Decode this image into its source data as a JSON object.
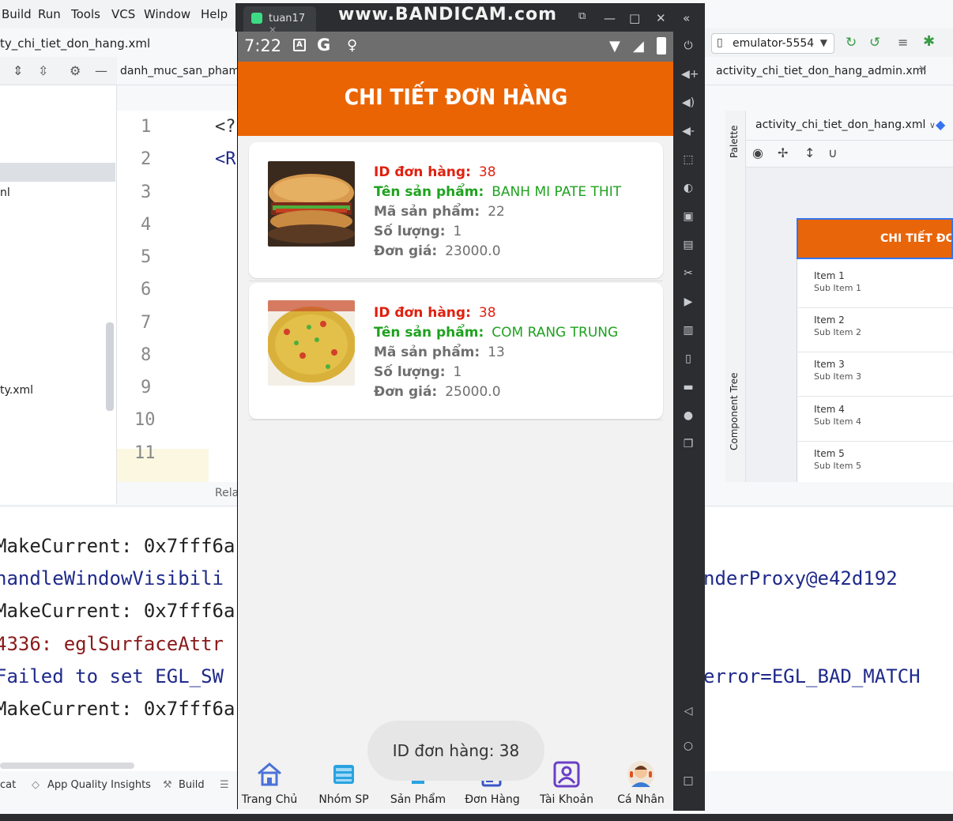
{
  "ide": {
    "menu": [
      "Build",
      "Run",
      "Tools",
      "VCS",
      "Window",
      "Help"
    ],
    "file_path": "ty_chi_tiet_don_hang.xml",
    "editor_tab": "danh_muc_san_pham.x",
    "tree_items": [
      "nl",
      "ty.xml"
    ],
    "line_numbers": [
      "1",
      "2",
      "3",
      "4",
      "5",
      "6",
      "7",
      "8",
      "9",
      "10",
      "11"
    ],
    "code_fragments": [
      "<?",
      "<R"
    ],
    "rela_tab": "Rela",
    "logcat_lines": [
      {
        "text": "MakeCurrent: 0x7fff6a",
        "color": "#1a1a1a"
      },
      {
        "text": " handleWindowVisibili",
        "color": "#1f2a8a"
      },
      {
        "text": "nderProxy@e42d192",
        "color": "#1f2a8a"
      },
      {
        "text": "MakeCurrent: 0x7fff6a",
        "color": "#1a1a1a"
      },
      {
        "text": " 4336: eglSurfaceAttr",
        "color": "#8a1a1a"
      },
      {
        "text": " Failed to set EGL_SW",
        "color": "#1f2a8a"
      },
      {
        "text": "error=EGL_BAD_MATCH",
        "color": "#1f2a8a"
      },
      {
        "text": "MakeCurrent: 0x7fff6a",
        "color": "#1a1a1a"
      }
    ],
    "bottom_tools": [
      "cat",
      "App Quality Insights",
      "Build"
    ],
    "device": "emulator-5554",
    "right_tab": "activity_chi_tiet_don_hang_admin.xml",
    "design_file": "activity_chi_tiet_don_hang.xml",
    "palette_label": "Palette",
    "component_tree_label": "Component Tree",
    "preview_title": "CHI TIẾT ĐƠN",
    "preview_items": [
      {
        "title": "Item 1",
        "sub": "Sub Item 1"
      },
      {
        "title": "Item 2",
        "sub": "Sub Item 2"
      },
      {
        "title": "Item 3",
        "sub": "Sub Item 3"
      },
      {
        "title": "Item 4",
        "sub": "Sub Item 4"
      },
      {
        "title": "Item 5",
        "sub": "Sub Item 5"
      }
    ]
  },
  "emulator": {
    "tab_name": "tuan17",
    "watermark": "www.BANDICAM.com"
  },
  "phone": {
    "time": "7:22",
    "title": "CHI TIẾT ĐƠN HÀNG",
    "orders": [
      {
        "id_label": "ID đơn hàng:",
        "id": "38",
        "name_label": "Tên sản phẩm:",
        "name": "BANH MI PATE THIT",
        "code_label": "Mã sản phẩm:",
        "code": "22",
        "qty_label": "Số lượng:",
        "qty": "1",
        "price_label": "Đơn giá:",
        "price": "23000.0"
      },
      {
        "id_label": "ID đơn hàng:",
        "id": "38",
        "name_label": "Tên sản phẩm:",
        "name": "COM RANG TRUNG",
        "code_label": "Mã sản phẩm:",
        "code": "13",
        "qty_label": "Số lượng:",
        "qty": "1",
        "price_label": "Đơn giá:",
        "price": "25000.0"
      }
    ],
    "toast": "ID đơn hàng: 38",
    "nav": [
      {
        "label": "Trang Chủ",
        "icon": "home-icon"
      },
      {
        "label": "Nhóm SP",
        "icon": "category-icon"
      },
      {
        "label": "Sản Phẩm",
        "icon": "chef-hat-icon"
      },
      {
        "label": "Đơn Hàng",
        "icon": "order-list-icon"
      },
      {
        "label": "Tài Khoản",
        "icon": "account-icon"
      },
      {
        "label": "Cá Nhân",
        "icon": "profile-avatar-icon"
      }
    ]
  },
  "colors": {
    "accent_orange": "#eb6404",
    "label_red": "#e0200f",
    "label_green": "#1fa21f"
  }
}
